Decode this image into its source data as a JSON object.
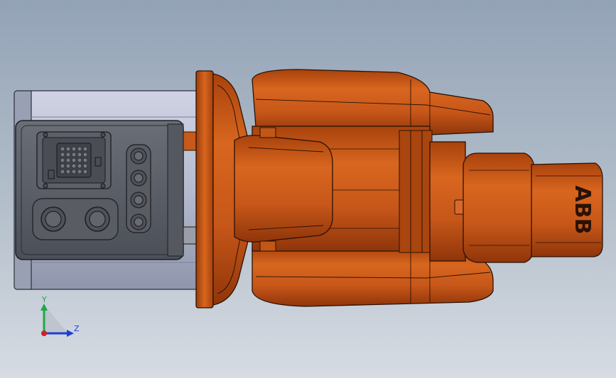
{
  "viewport": {
    "background_top": "#93a3b6",
    "background_bottom": "#d7dce3",
    "model": {
      "part": "abb-robot-arm",
      "housing_color": "#c45518",
      "base_color": "#b9c0d4",
      "connector_plate_color": "#5a5e66"
    },
    "logo": {
      "text": "ABB",
      "color": "#2a1206"
    },
    "triad": {
      "y_label": "Y",
      "z_label": "Z",
      "y_color": "#1fa84a",
      "z_color": "#1d3fd8",
      "x_color": "#d0202a"
    }
  }
}
